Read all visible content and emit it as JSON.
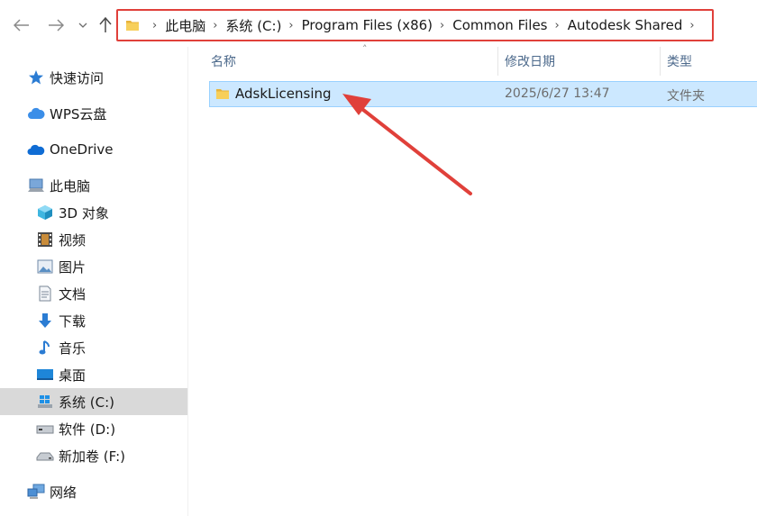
{
  "breadcrumb": {
    "items": [
      "此电脑",
      "系统 (C:)",
      "Program Files (x86)",
      "Common Files",
      "Autodesk Shared"
    ]
  },
  "sidebar": {
    "items": [
      {
        "label": "快速访问",
        "icon": "star-icon"
      },
      {
        "label": "WPS云盘",
        "icon": "cloud-icon"
      },
      {
        "label": "OneDrive",
        "icon": "onedrive-icon"
      },
      {
        "label": "此电脑",
        "icon": "computer-icon"
      },
      {
        "label": "3D 对象",
        "icon": "cube-icon"
      },
      {
        "label": "视频",
        "icon": "film-icon"
      },
      {
        "label": "图片",
        "icon": "picture-icon"
      },
      {
        "label": "文档",
        "icon": "document-icon"
      },
      {
        "label": "下载",
        "icon": "download-icon"
      },
      {
        "label": "音乐",
        "icon": "music-icon"
      },
      {
        "label": "桌面",
        "icon": "desktop-icon"
      },
      {
        "label": "系统 (C:)",
        "icon": "windows-drive-icon"
      },
      {
        "label": "软件 (D:)",
        "icon": "drive-icon"
      },
      {
        "label": "新加卷 (F:)",
        "icon": "drive-icon"
      },
      {
        "label": "网络",
        "icon": "network-icon"
      }
    ],
    "selected": "系统 (C:)"
  },
  "columns": {
    "name": "名称",
    "date": "修改日期",
    "type": "类型"
  },
  "files": [
    {
      "name": "AdskLicensing",
      "date": "2025/6/27 13:47",
      "type": "文件夹",
      "icon": "folder-icon"
    }
  ],
  "colors": {
    "highlight_box": "#e0403a",
    "selection": "#cce8ff",
    "annotation_arrow": "#e0403a"
  }
}
